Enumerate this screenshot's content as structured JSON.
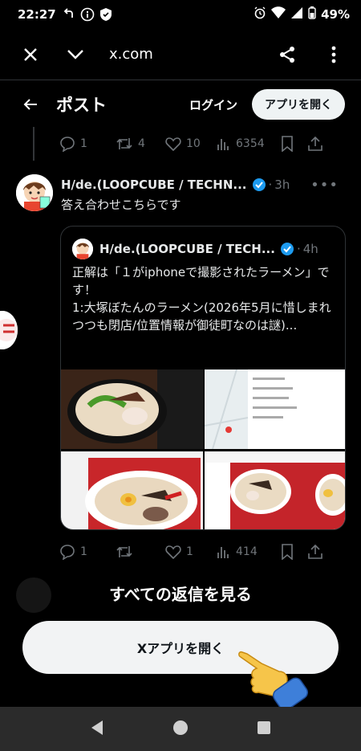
{
  "status_bar": {
    "time": "22:27",
    "battery": "49%"
  },
  "browser": {
    "url": "x.com"
  },
  "post_header": {
    "title": "ポスト",
    "login": "ログイン",
    "open_app": "アプリを開く"
  },
  "prev_actions": {
    "replies": "1",
    "retweets": "4",
    "likes": "10",
    "views": "6354"
  },
  "tweet": {
    "author": "H/de.(LOOPCUBE / TECHN...",
    "time": "3h",
    "text": "答え合わせこちらです",
    "quote": {
      "author": "H/de.(LOOPCUBE / TECH...",
      "time": "4h",
      "text": "正解は「１がiphoneで撮影されたラーメン」です！\n1:大塚ぼたんのラーメン(2026年5月に惜しまれつつも閉店/位置情報が御徒町なのは謎)..."
    },
    "actions": {
      "replies": "1",
      "retweets": "",
      "likes": "1",
      "views": "414"
    }
  },
  "bottom": {
    "see_all": "すべての返信を見る",
    "cta": "Xアプリを開く"
  },
  "colors": {
    "accent": "#1d9bf0",
    "bg": "#000000",
    "muted": "#71767b"
  }
}
